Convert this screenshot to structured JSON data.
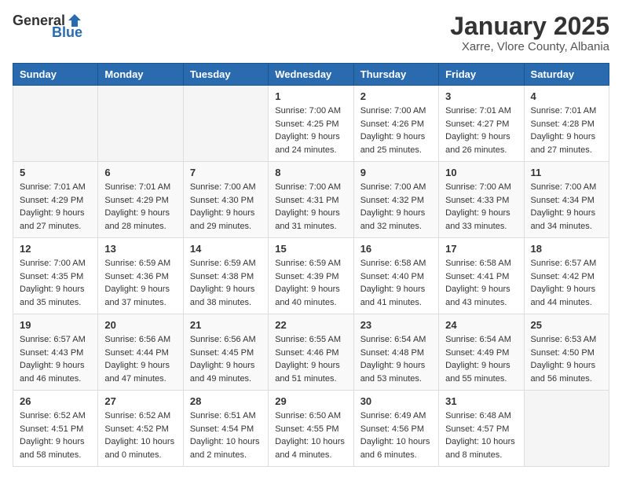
{
  "logo": {
    "general": "General",
    "blue": "Blue"
  },
  "title": "January 2025",
  "subtitle": "Xarre, Vlore County, Albania",
  "weekdays": [
    "Sunday",
    "Monday",
    "Tuesday",
    "Wednesday",
    "Thursday",
    "Friday",
    "Saturday"
  ],
  "weeks": [
    [
      {
        "day": "",
        "info": ""
      },
      {
        "day": "",
        "info": ""
      },
      {
        "day": "",
        "info": ""
      },
      {
        "day": "1",
        "info": "Sunrise: 7:00 AM\nSunset: 4:25 PM\nDaylight: 9 hours\nand 24 minutes."
      },
      {
        "day": "2",
        "info": "Sunrise: 7:00 AM\nSunset: 4:26 PM\nDaylight: 9 hours\nand 25 minutes."
      },
      {
        "day": "3",
        "info": "Sunrise: 7:01 AM\nSunset: 4:27 PM\nDaylight: 9 hours\nand 26 minutes."
      },
      {
        "day": "4",
        "info": "Sunrise: 7:01 AM\nSunset: 4:28 PM\nDaylight: 9 hours\nand 27 minutes."
      }
    ],
    [
      {
        "day": "5",
        "info": "Sunrise: 7:01 AM\nSunset: 4:29 PM\nDaylight: 9 hours\nand 27 minutes."
      },
      {
        "day": "6",
        "info": "Sunrise: 7:01 AM\nSunset: 4:29 PM\nDaylight: 9 hours\nand 28 minutes."
      },
      {
        "day": "7",
        "info": "Sunrise: 7:00 AM\nSunset: 4:30 PM\nDaylight: 9 hours\nand 29 minutes."
      },
      {
        "day": "8",
        "info": "Sunrise: 7:00 AM\nSunset: 4:31 PM\nDaylight: 9 hours\nand 31 minutes."
      },
      {
        "day": "9",
        "info": "Sunrise: 7:00 AM\nSunset: 4:32 PM\nDaylight: 9 hours\nand 32 minutes."
      },
      {
        "day": "10",
        "info": "Sunrise: 7:00 AM\nSunset: 4:33 PM\nDaylight: 9 hours\nand 33 minutes."
      },
      {
        "day": "11",
        "info": "Sunrise: 7:00 AM\nSunset: 4:34 PM\nDaylight: 9 hours\nand 34 minutes."
      }
    ],
    [
      {
        "day": "12",
        "info": "Sunrise: 7:00 AM\nSunset: 4:35 PM\nDaylight: 9 hours\nand 35 minutes."
      },
      {
        "day": "13",
        "info": "Sunrise: 6:59 AM\nSunset: 4:36 PM\nDaylight: 9 hours\nand 37 minutes."
      },
      {
        "day": "14",
        "info": "Sunrise: 6:59 AM\nSunset: 4:38 PM\nDaylight: 9 hours\nand 38 minutes."
      },
      {
        "day": "15",
        "info": "Sunrise: 6:59 AM\nSunset: 4:39 PM\nDaylight: 9 hours\nand 40 minutes."
      },
      {
        "day": "16",
        "info": "Sunrise: 6:58 AM\nSunset: 4:40 PM\nDaylight: 9 hours\nand 41 minutes."
      },
      {
        "day": "17",
        "info": "Sunrise: 6:58 AM\nSunset: 4:41 PM\nDaylight: 9 hours\nand 43 minutes."
      },
      {
        "day": "18",
        "info": "Sunrise: 6:57 AM\nSunset: 4:42 PM\nDaylight: 9 hours\nand 44 minutes."
      }
    ],
    [
      {
        "day": "19",
        "info": "Sunrise: 6:57 AM\nSunset: 4:43 PM\nDaylight: 9 hours\nand 46 minutes."
      },
      {
        "day": "20",
        "info": "Sunrise: 6:56 AM\nSunset: 4:44 PM\nDaylight: 9 hours\nand 47 minutes."
      },
      {
        "day": "21",
        "info": "Sunrise: 6:56 AM\nSunset: 4:45 PM\nDaylight: 9 hours\nand 49 minutes."
      },
      {
        "day": "22",
        "info": "Sunrise: 6:55 AM\nSunset: 4:46 PM\nDaylight: 9 hours\nand 51 minutes."
      },
      {
        "day": "23",
        "info": "Sunrise: 6:54 AM\nSunset: 4:48 PM\nDaylight: 9 hours\nand 53 minutes."
      },
      {
        "day": "24",
        "info": "Sunrise: 6:54 AM\nSunset: 4:49 PM\nDaylight: 9 hours\nand 55 minutes."
      },
      {
        "day": "25",
        "info": "Sunrise: 6:53 AM\nSunset: 4:50 PM\nDaylight: 9 hours\nand 56 minutes."
      }
    ],
    [
      {
        "day": "26",
        "info": "Sunrise: 6:52 AM\nSunset: 4:51 PM\nDaylight: 9 hours\nand 58 minutes."
      },
      {
        "day": "27",
        "info": "Sunrise: 6:52 AM\nSunset: 4:52 PM\nDaylight: 10 hours\nand 0 minutes."
      },
      {
        "day": "28",
        "info": "Sunrise: 6:51 AM\nSunset: 4:54 PM\nDaylight: 10 hours\nand 2 minutes."
      },
      {
        "day": "29",
        "info": "Sunrise: 6:50 AM\nSunset: 4:55 PM\nDaylight: 10 hours\nand 4 minutes."
      },
      {
        "day": "30",
        "info": "Sunrise: 6:49 AM\nSunset: 4:56 PM\nDaylight: 10 hours\nand 6 minutes."
      },
      {
        "day": "31",
        "info": "Sunrise: 6:48 AM\nSunset: 4:57 PM\nDaylight: 10 hours\nand 8 minutes."
      },
      {
        "day": "",
        "info": ""
      }
    ]
  ]
}
